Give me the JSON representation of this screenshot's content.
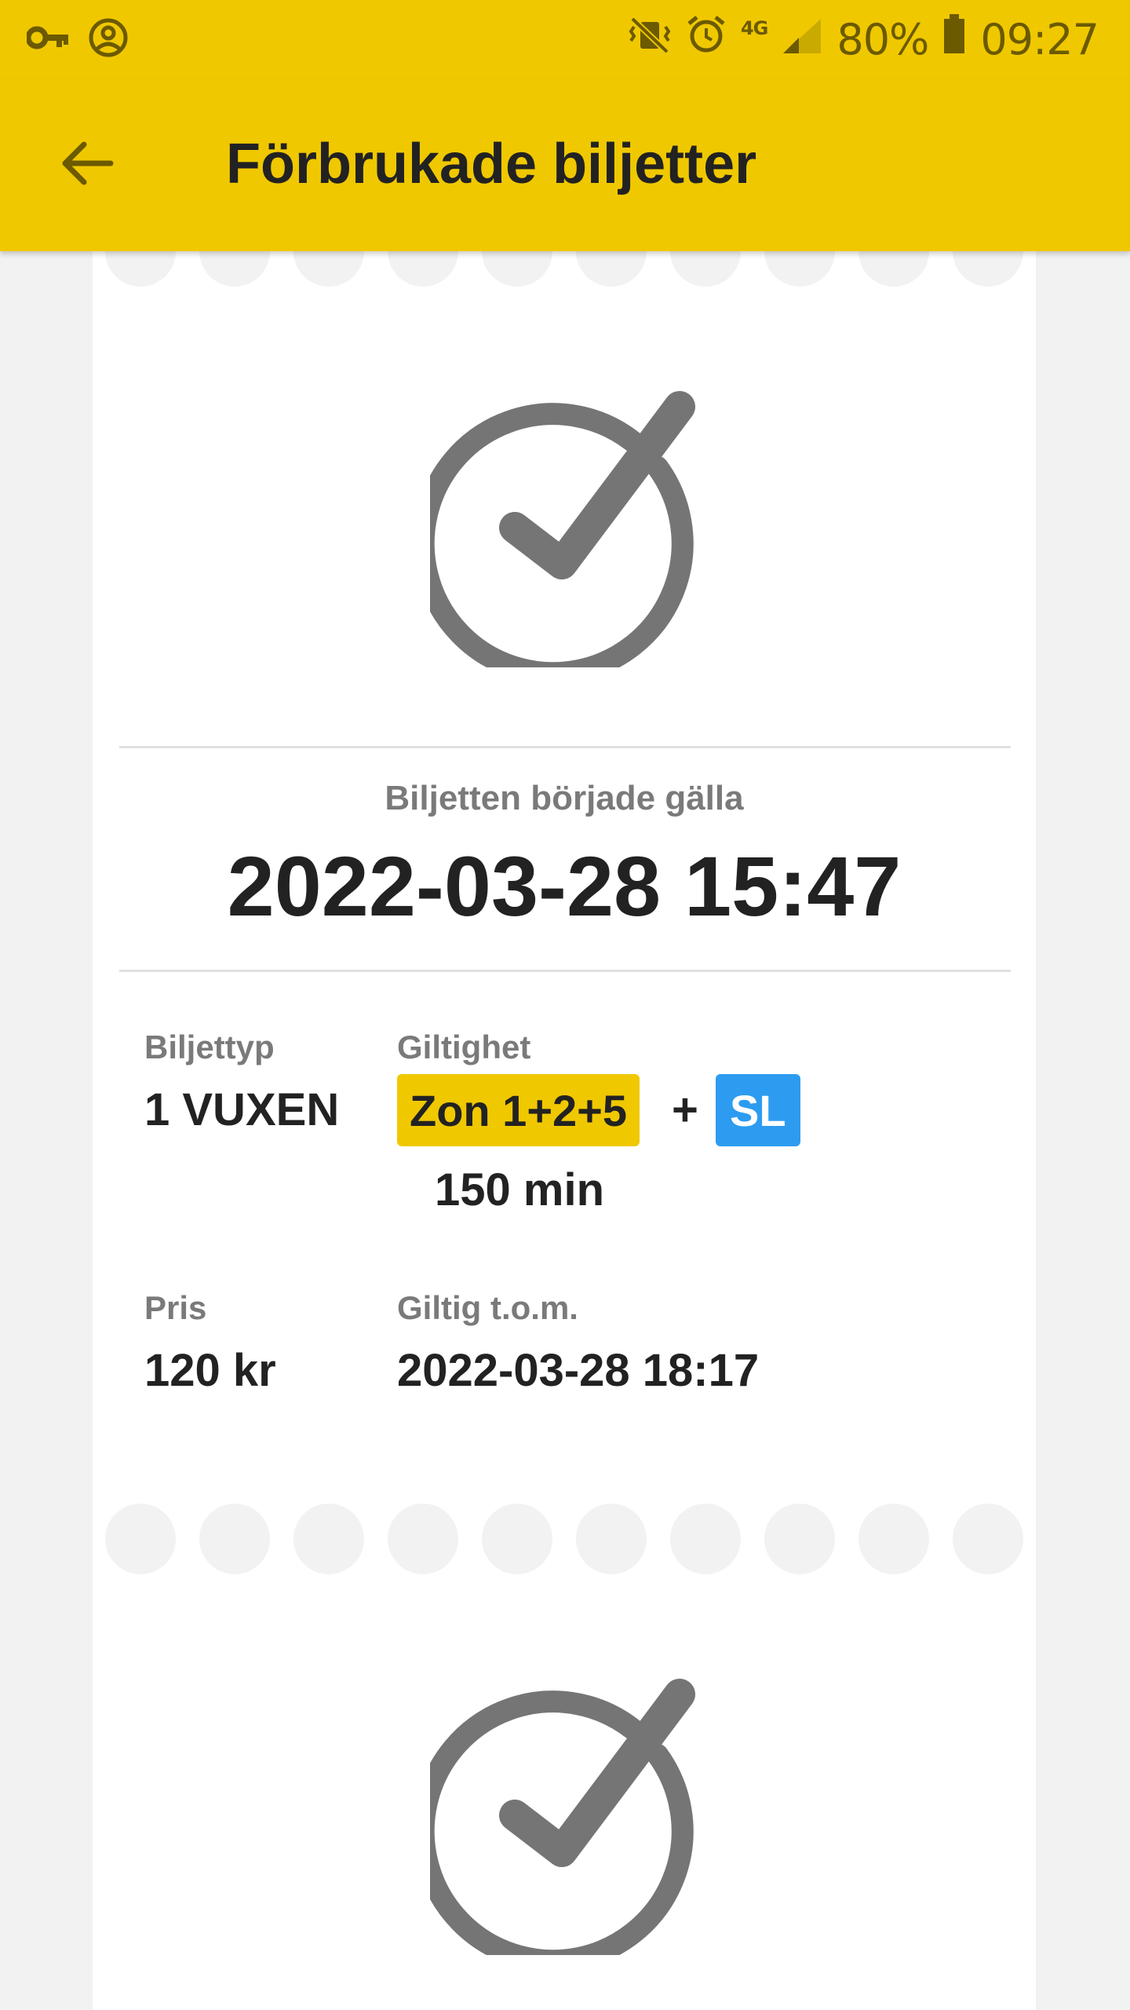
{
  "status_bar": {
    "network": "4G",
    "battery": "80%",
    "time": "09:27",
    "icons": [
      "key-icon",
      "account-circle-icon",
      "mute-vibrate-icon",
      "alarm-icon",
      "signal-icon",
      "battery-icon"
    ]
  },
  "app_bar": {
    "title": "Förbrukade biljetter",
    "back_icon": "arrow-back-icon"
  },
  "ticket": {
    "status_icon": "check-circle-icon",
    "start_label": "Biljetten började gälla",
    "start_datetime": "2022-03-28 15:47",
    "type_label": "Biljettyp",
    "type_value": "1 VUXEN",
    "validity_label": "Giltighet",
    "zone": "Zon 1+2+5",
    "plus": "+",
    "operator": "SL",
    "duration": "150 min",
    "price_label": "Pris",
    "price_value": "120 kr",
    "valid_until_label": "Giltig t.o.m.",
    "valid_until_value": "2022-03-28 18:17"
  },
  "colors": {
    "brand_yellow": "#f0c800",
    "sl_blue": "#2d9cf0",
    "icon_gray": "#757575"
  }
}
